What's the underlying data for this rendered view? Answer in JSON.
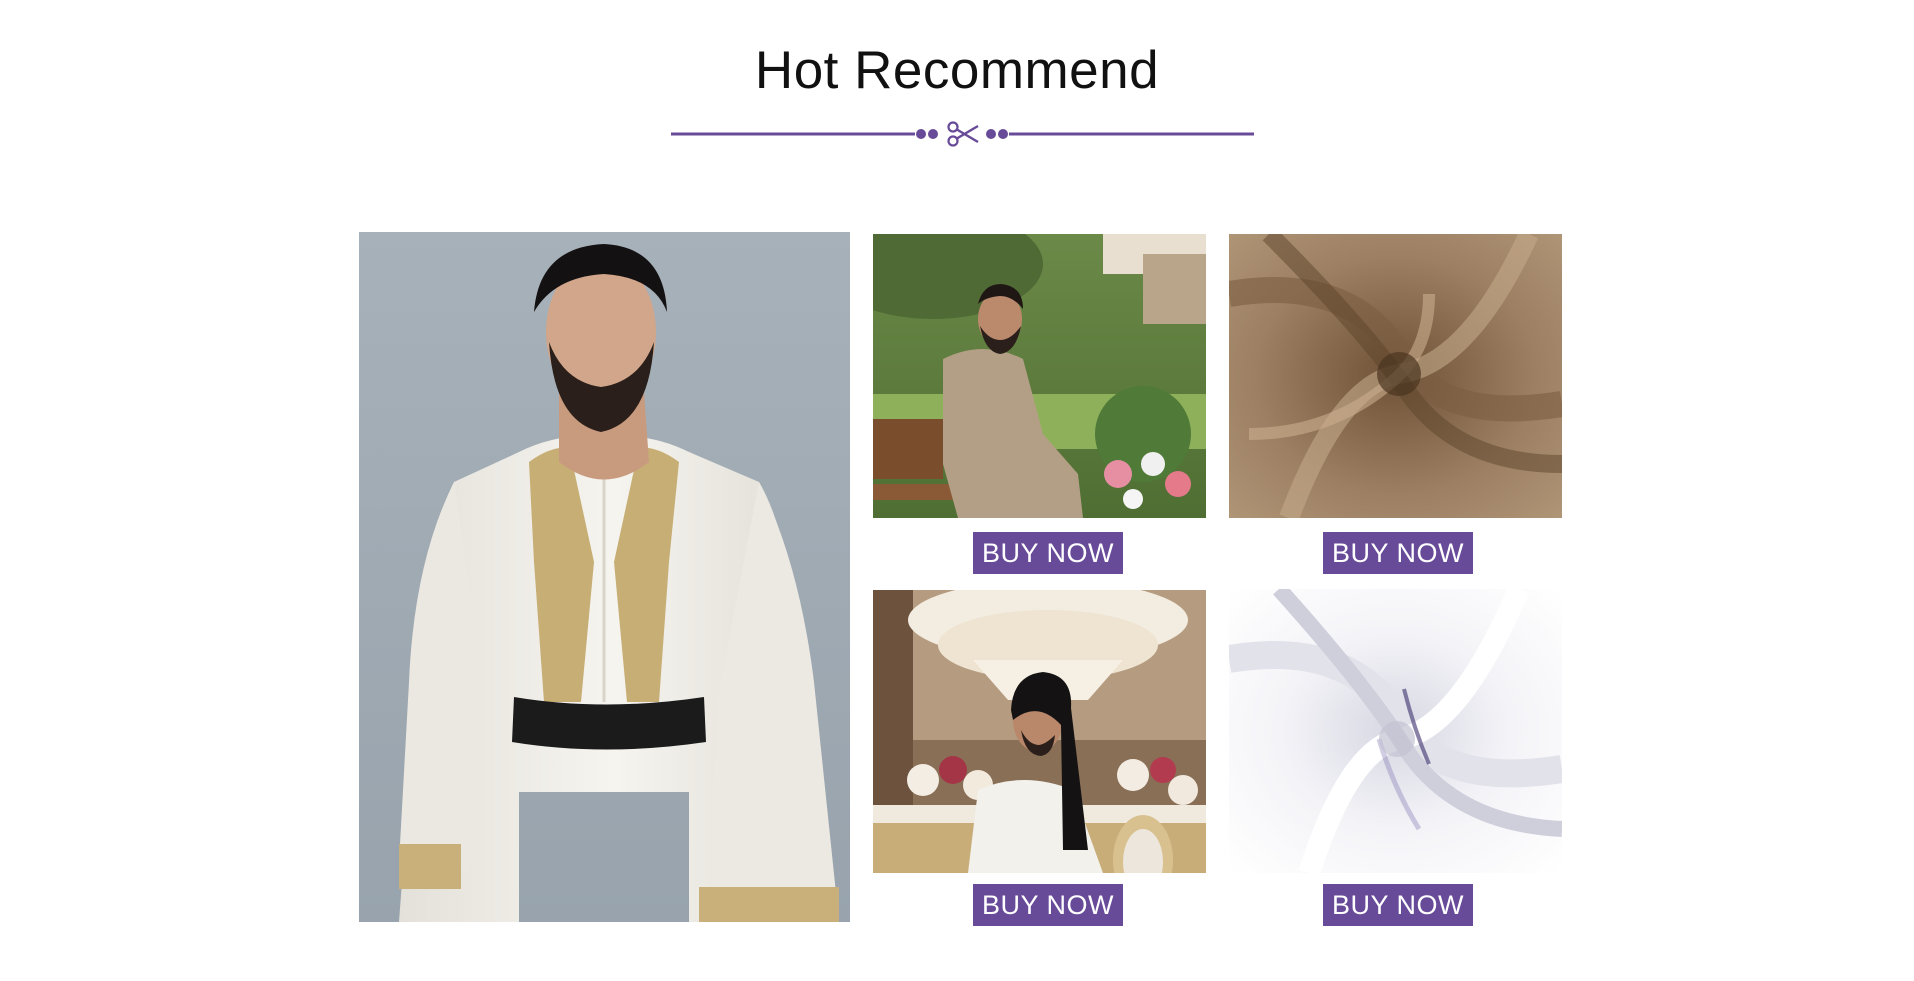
{
  "section": {
    "title": "Hot Recommend",
    "accent_color": "#674b98",
    "divider_icon": "scissors-icon"
  },
  "products": [
    {
      "label": "BUY NOW",
      "image": "man-in-beige-thobe-garden"
    },
    {
      "label": "BUY NOW",
      "image": "brown-fabric-swirl",
      "watermark": ""
    },
    {
      "label": "BUY NOW",
      "image": "man-in-white-thobe-banquet"
    },
    {
      "label": "BUY NOW",
      "image": "white-satin-fabric-swirl"
    }
  ],
  "featured": {
    "image": "man-in-white-embroidered-thobe"
  }
}
